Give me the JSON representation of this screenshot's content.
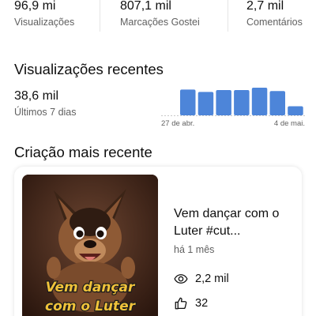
{
  "stats": [
    {
      "value": "96,9 mi",
      "label": "Visualizações"
    },
    {
      "value": "807,1 mil",
      "label": "Marcações Gostei"
    },
    {
      "value": "2,7 mil",
      "label": "Comentários"
    }
  ],
  "recent_views": {
    "title": "Visualizações recentes",
    "value": "38,6 mil",
    "period": "Últimos 7 dias"
  },
  "chart_data": {
    "type": "bar",
    "categories": [
      "27 de abr.",
      "",
      "",
      "",
      "",
      "",
      "4 de mai."
    ],
    "values": [
      5.4,
      4.9,
      5.3,
      5.3,
      5.8,
      5.1,
      1.9
    ],
    "x_tick_labels": [
      "27 de abr.",
      "4 de mai."
    ],
    "colors": {
      "bars": "#4d85d9",
      "baseline": "#c8c8c8"
    },
    "grid": false
  },
  "latest": {
    "title": "Criação mais recente",
    "video_title": "Vem dançar com o Luter #cut...",
    "age": "há 1 mês",
    "views": "2,2 mil",
    "likes": "32",
    "thumbnail_caption_line1": "Vem dançar",
    "thumbnail_caption_line2": "com o Luter"
  },
  "icons": {
    "views": "eye-icon",
    "likes": "thumbs-up-icon"
  },
  "colors": {
    "text": "#0f0f0f",
    "secondary_text": "#606060",
    "accent_bar": "#4d85d9",
    "caption_fill": "#f0c23a"
  }
}
